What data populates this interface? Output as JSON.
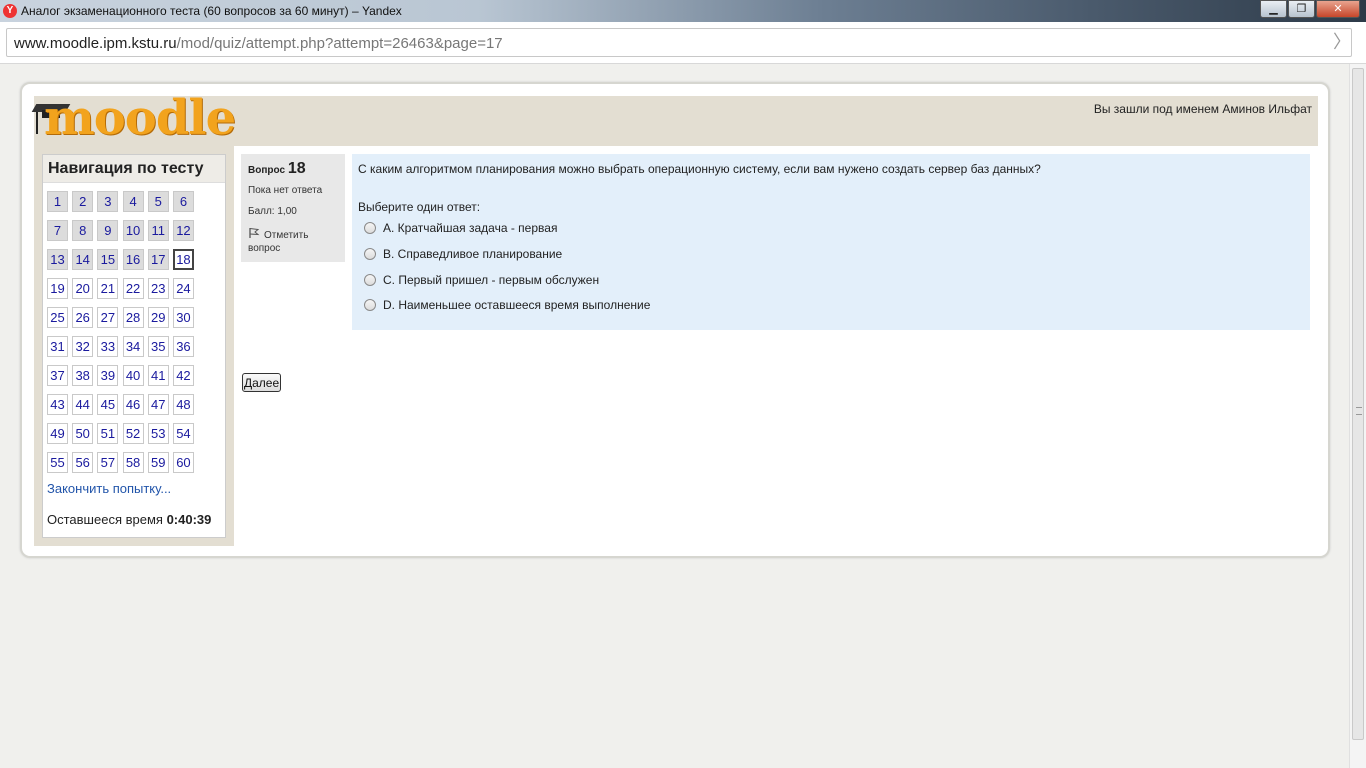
{
  "window": {
    "title": "Аналог экзаменационного теста (60 вопросов за 60 минут) – Yandex",
    "app_icon": "yandex-icon",
    "btn_minimize": "▁",
    "btn_maximize": "❐",
    "btn_close": "✕"
  },
  "address_bar": {
    "host": "www.moodle.ipm.kstu.ru",
    "path": "/mod/quiz/attempt.php?attempt=26463&page=17"
  },
  "header": {
    "logo_text": "moodle",
    "logged_in": "Вы зашли под именем Аминов Ильфат"
  },
  "navigation": {
    "title": "Навигация по тесту",
    "questions": [
      "1",
      "2",
      "3",
      "4",
      "5",
      "6",
      "7",
      "8",
      "9",
      "10",
      "11",
      "12",
      "13",
      "14",
      "15",
      "16",
      "17",
      "18",
      "19",
      "20",
      "21",
      "22",
      "23",
      "24",
      "25",
      "26",
      "27",
      "28",
      "29",
      "30",
      "31",
      "32",
      "33",
      "34",
      "35",
      "36",
      "37",
      "38",
      "39",
      "40",
      "41",
      "42",
      "43",
      "44",
      "45",
      "46",
      "47",
      "48",
      "49",
      "50",
      "51",
      "52",
      "53",
      "54",
      "55",
      "56",
      "57",
      "58",
      "59",
      "60"
    ],
    "answered_count": 17,
    "current": "18",
    "finish_link": "Закончить попытку...",
    "timer_label": "Оставшееся время",
    "timer_value": "0:40:39"
  },
  "question_info": {
    "label": "Вопрос",
    "number": "18",
    "state": "Пока нет ответа",
    "grade": "Балл: 1,00",
    "flag": "Отметить вопрос"
  },
  "question": {
    "text": "С каким алгоритмом планирования можно выбрать операционную систему, если вам нужено создать сервер баз данных?",
    "prompt": "Выберите один ответ:",
    "answers": [
      "A. Кратчайшая задача - первая",
      "B. Справедливое планирование",
      "C. Первый пришел - первым обслужен",
      "D. Наименьшее оставшееся время выполнение"
    ]
  },
  "next_button": "Далее",
  "colors": {
    "accent_logo": "#f2a31d",
    "header_bg": "#e3ded2",
    "question_bg": "#e3effa",
    "link": "#2255aa"
  }
}
